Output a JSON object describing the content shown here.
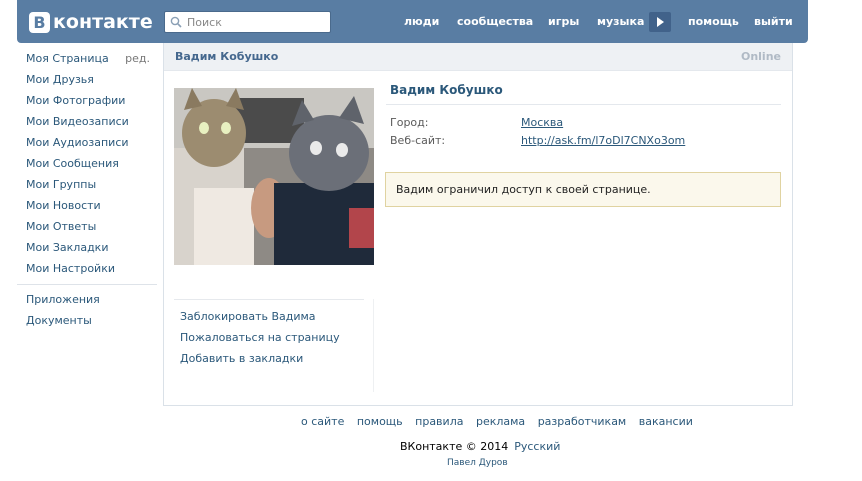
{
  "header": {
    "logo_letter": "В",
    "logo_text": "контакте",
    "search_placeholder": "Поиск",
    "nav": [
      "люди",
      "сообщества",
      "игры",
      "музыка",
      "помощь",
      "выйти"
    ],
    "accent_color": "#597da3"
  },
  "left_menu": {
    "items": [
      "Моя Страница",
      "Мои Друзья",
      "Мои Фотографии",
      "Мои Видеозаписи",
      "Мои Аудиозаписи",
      "Мои Сообщения",
      "Мои Группы",
      "Мои Новости",
      "Мои Ответы",
      "Мои Закладки",
      "Мои Настройки"
    ],
    "edit_label": "ред.",
    "extra_items": [
      "Приложения",
      "Документы"
    ]
  },
  "profile": {
    "header_name": "Вадим Кобушко",
    "status": "Online",
    "name": "Вадим Кобушко",
    "info": [
      {
        "label": "Город:",
        "value": "Москва"
      },
      {
        "label": "Веб-сайт:",
        "value": "http://ask.fm/l7oDl7CNXo3om"
      }
    ],
    "restricted_notice": "Вадим ограничил доступ к своей странице.",
    "actions": [
      "Заблокировать Вадима",
      "Пожаловаться на страницу",
      "Добавить в закладки"
    ]
  },
  "footer": {
    "links": [
      "о сайте",
      "помощь",
      "правила",
      "реклама",
      "разработчикам",
      "вакансии"
    ],
    "copyright": "ВКонтакте © 2014",
    "language": "Русский",
    "author": "Павел Дуров"
  }
}
